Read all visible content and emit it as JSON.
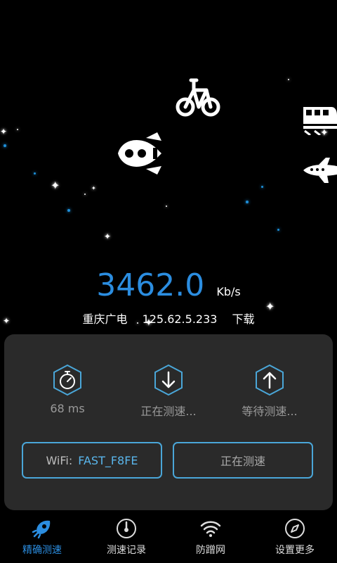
{
  "speed": {
    "value": "3462.0",
    "unit": "Kb/s"
  },
  "connection": {
    "isp": "重庆广电",
    "ip": "125.62.5.233",
    "status": "下载"
  },
  "metrics": [
    {
      "icon": "stopwatch-icon",
      "label": "68 ms"
    },
    {
      "icon": "download-arrow-icon",
      "label": "正在测速..."
    },
    {
      "icon": "upload-arrow-icon",
      "label": "等待测速..."
    }
  ],
  "wifi": {
    "label": "WiFi:",
    "value": "FAST_F8FE"
  },
  "test_button": {
    "label": "正在测速"
  },
  "nav": [
    {
      "icon": "rocket-icon",
      "label": "精确测速",
      "active": true
    },
    {
      "icon": "gauge-icon",
      "label": "测速记录",
      "active": false
    },
    {
      "icon": "wifi-icon",
      "label": "防蹭网",
      "active": false
    },
    {
      "icon": "compass-icon",
      "label": "设置更多",
      "active": false
    }
  ],
  "colors": {
    "accent": "#2b8de0",
    "panel": "#2a2a2a",
    "border": "#4aa6d8",
    "background": "#000000"
  }
}
